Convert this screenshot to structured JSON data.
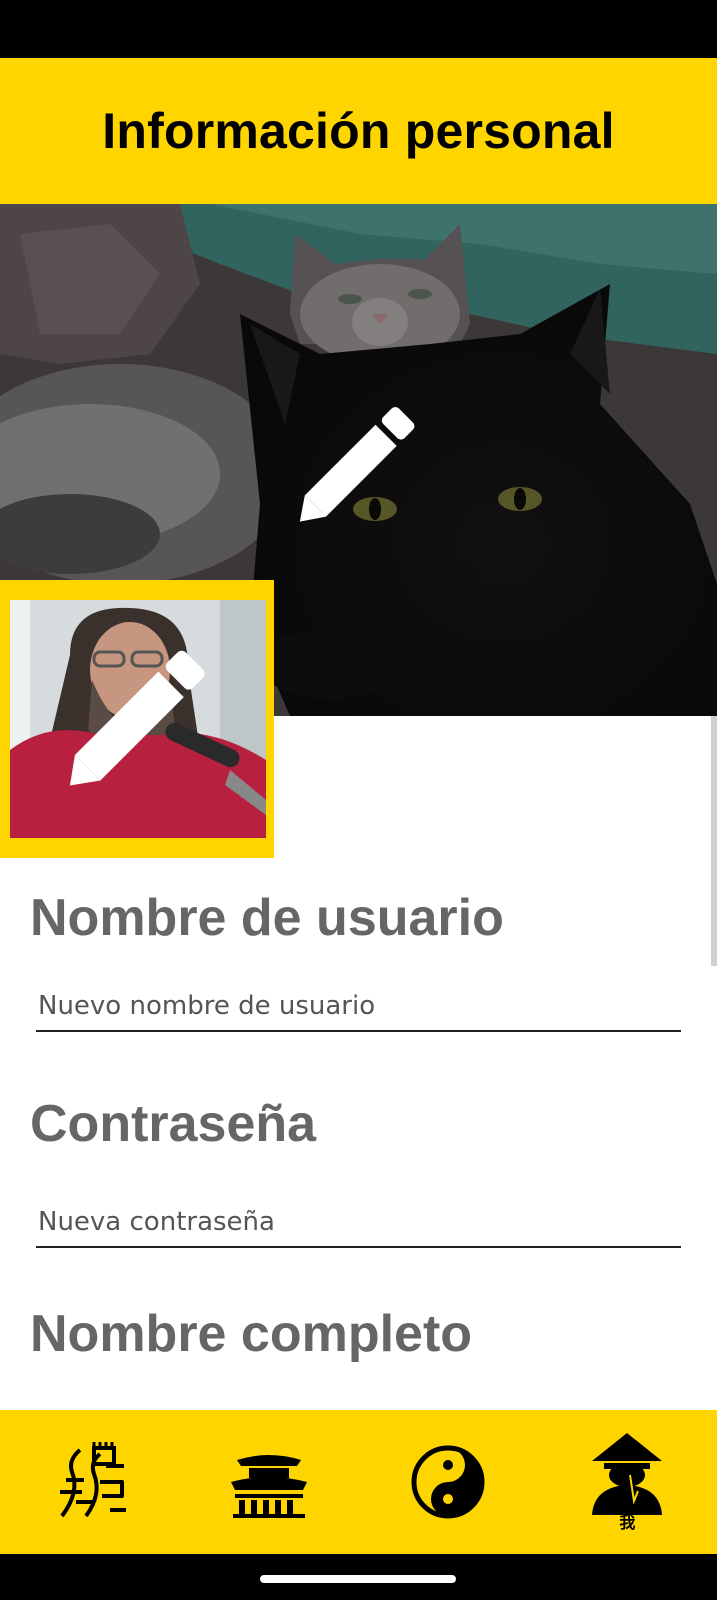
{
  "header": {
    "title": "Información personal"
  },
  "profile": {
    "cover_alt": "cover-photo",
    "avatar_alt": "profile-photo"
  },
  "form": {
    "username": {
      "label": "Nombre de usuario",
      "placeholder": "Nuevo nombre de usuario",
      "value": ""
    },
    "password": {
      "label": "Contraseña",
      "placeholder": "Nueva contraseña",
      "value": ""
    },
    "fullname": {
      "label": "Nombre completo"
    }
  },
  "bottom_nav": {
    "items": [
      {
        "icon": "great-wall-icon",
        "label": ""
      },
      {
        "icon": "temple-icon",
        "label": ""
      },
      {
        "icon": "yin-yang-icon",
        "label": ""
      },
      {
        "icon": "person-hat-icon",
        "label": "我"
      }
    ]
  },
  "colors": {
    "accent": "#FFD500",
    "label_text": "#666666",
    "background": "#FFFFFF"
  }
}
